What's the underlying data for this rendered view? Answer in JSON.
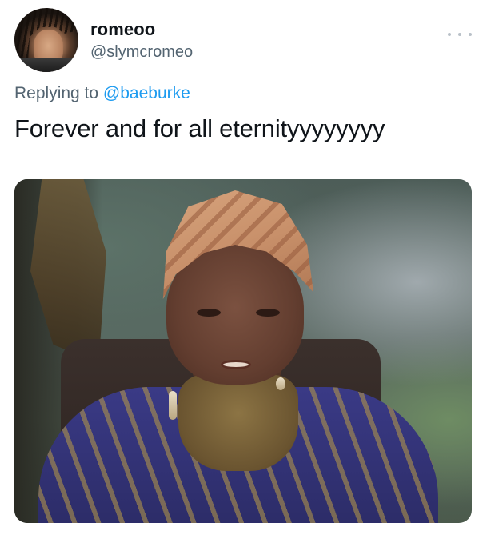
{
  "author": {
    "display_name": "romeoo",
    "handle": "@slymcromeo",
    "avatar_icon": "user-avatar-icon"
  },
  "reply": {
    "prefix": "Replying to",
    "mention": "@baeburke"
  },
  "tweet": {
    "text": "Forever and for all eternityyyyyyyy"
  },
  "media": {
    "type": "image"
  },
  "colors": {
    "text_primary": "#0f1419",
    "text_secondary": "#536471",
    "link": "#1d9bf0"
  }
}
